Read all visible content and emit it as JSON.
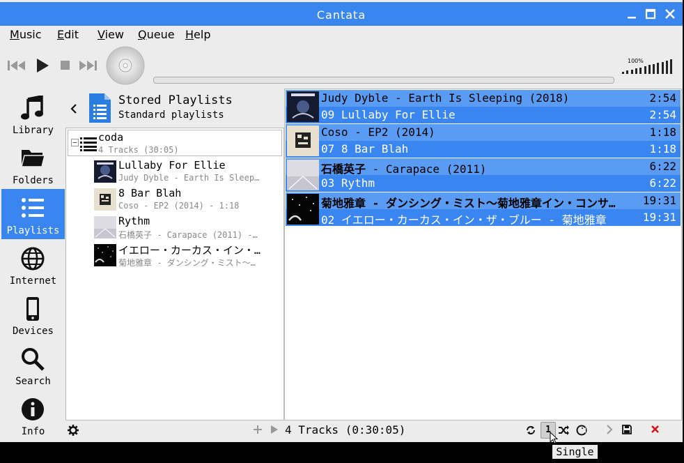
{
  "window": {
    "title": "Cantata"
  },
  "menubar": {
    "items": [
      {
        "label": "Music",
        "u": "M",
        "rest": "usic"
      },
      {
        "label": "Edit",
        "u": "E",
        "rest": "dit"
      },
      {
        "label": "View",
        "u": "V",
        "rest": "iew"
      },
      {
        "label": "Queue",
        "u": "Q",
        "rest": "ueue"
      },
      {
        "label": "Help",
        "u": "H",
        "rest": "elp"
      }
    ]
  },
  "player": {
    "volume_label": "100%",
    "volume_level": 1.0,
    "progress": 0
  },
  "sidebar": {
    "items": [
      {
        "label": "Library",
        "icon": "music-note-icon"
      },
      {
        "label": "Folders",
        "icon": "folder-icon"
      },
      {
        "label": "Playlists",
        "icon": "list-icon",
        "selected": true
      },
      {
        "label": "Internet",
        "icon": "globe-icon"
      },
      {
        "label": "Devices",
        "icon": "phone-icon"
      },
      {
        "label": "Search",
        "icon": "search-icon"
      },
      {
        "label": "Info",
        "icon": "info-icon"
      }
    ]
  },
  "playlists_panel": {
    "title": "Stored Playlists",
    "subtitle": "Standard playlists",
    "playlist": {
      "name": "coda",
      "summary": "4 Tracks (30:05)"
    },
    "tracks": [
      {
        "title": "Lullaby For Ellie",
        "sub": "Judy Dyble - Earth Is Sleep…"
      },
      {
        "title": "8 Bar Blah",
        "sub": "Coso - EP2 (2014) - 1:18"
      },
      {
        "title": "Rythm",
        "sub": "石橋英子 - Carapace (2011) -…"
      },
      {
        "title": "イエロー・カーカス・イン・…",
        "sub": "菊地雅章 - ダンシング・ミスト〜…"
      }
    ]
  },
  "queue": {
    "groups": [
      {
        "header": "Judy Dyble - Earth Is Sleeping (2018)",
        "header_time": "2:54",
        "track": "09 Lullaby For Ellie",
        "time": "2:54",
        "bold": false
      },
      {
        "header": "Coso - EP2 (2014)",
        "header_time": "1:18",
        "track": "07 8 Bar Blah",
        "time": "1:18",
        "bold": false
      },
      {
        "header_bold": "石橋英子",
        "header": " - Carapace (2011)",
        "header_time": "6:22",
        "track": "03 Rythm",
        "time": "6:22",
        "bold": true
      },
      {
        "header_bold": "菊地雅章 - ダンシング・ミスト〜菊地雅章イン・コンサ…",
        "header": "",
        "header_time": "19:31",
        "track": "02 イエロー・カーカス・イン・ザ・ブルー - 菊地雅章",
        "time": "19:31",
        "bold": true
      }
    ]
  },
  "bottombar": {
    "summary": "4 Tracks (0:30:05)",
    "single_label": "1"
  },
  "tooltip": {
    "text": "Single"
  },
  "colors": {
    "accent": "#3a86f0"
  }
}
